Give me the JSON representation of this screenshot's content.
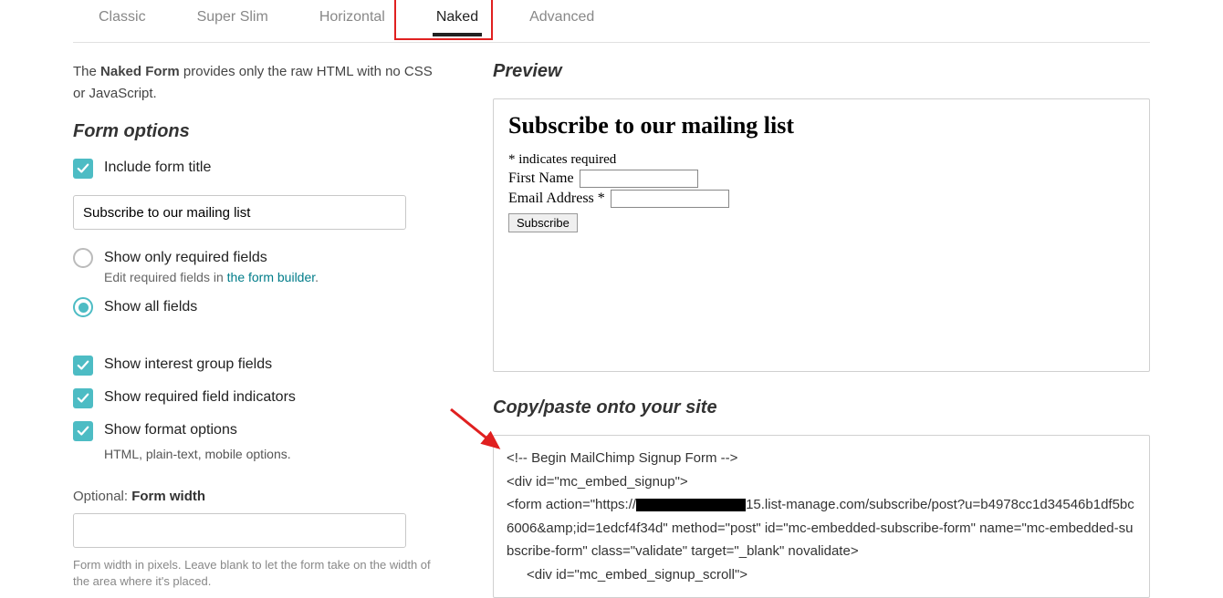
{
  "tabs": {
    "items": [
      {
        "label": "Classic"
      },
      {
        "label": "Super Slim"
      },
      {
        "label": "Horizontal"
      },
      {
        "label": "Naked"
      },
      {
        "label": "Advanced"
      }
    ],
    "selected_index": 3
  },
  "intro": {
    "prefix": "The ",
    "bold": "Naked Form",
    "suffix": " provides only the raw HTML with no CSS or JavaScript."
  },
  "form_options_title": "Form options",
  "include_title": {
    "label": "Include form title",
    "value": "Subscribe to our mailing list"
  },
  "required_radio": {
    "only_label": "Show only required fields",
    "edit_prefix": "Edit required fields in ",
    "edit_link": "the form builder",
    "edit_suffix": ".",
    "all_label": "Show all fields"
  },
  "checks": {
    "interest_groups": "Show interest group fields",
    "required_indicators": "Show required field indicators",
    "format_options": "Show format options",
    "format_sub": "HTML, plain-text, mobile options."
  },
  "form_width": {
    "label_prefix": "Optional: ",
    "label_bold": "Form width",
    "help": "Form width in pixels. Leave blank to let the form take on the width of the area where it's placed."
  },
  "preview": {
    "title": "Preview",
    "heading": "Subscribe to our mailing list",
    "required_note": "* indicates required",
    "first_name_label": "First Name",
    "email_label": "Email Address *",
    "subscribe_btn": "Subscribe"
  },
  "code": {
    "title": "Copy/paste onto your site",
    "line1": "<!-- Begin MailChimp Signup Form -->",
    "line2": "<div id=\"mc_embed_signup\">",
    "line3a": "<form action=\"https://",
    "line3b": "15.list-manage.com/subscribe/post?u=b4978cc1d34546b1df5bc6006&amp;id=1edcf4f34d\" method=\"post\" id=\"mc-embedded-subscribe-form\" name=\"mc-embedded-subscribe-form\" class=\"validate\" target=\"_blank\" novalidate>",
    "line4": "<div id=\"mc_embed_signup_scroll\">"
  }
}
